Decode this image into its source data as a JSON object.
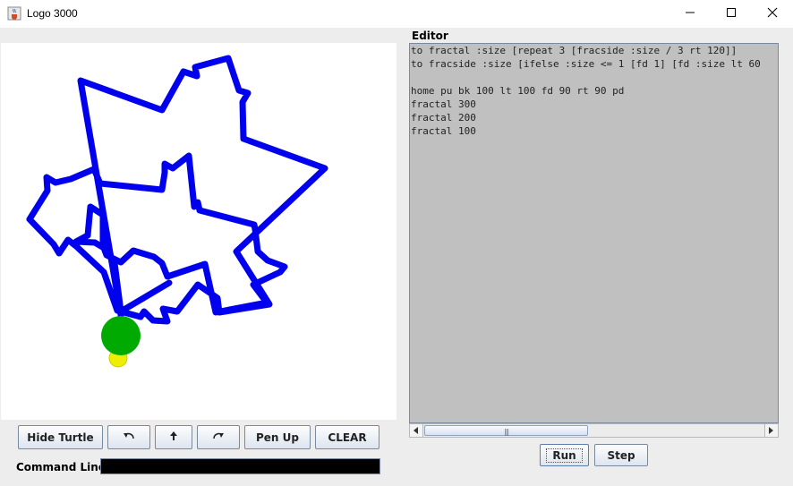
{
  "window": {
    "title": "Logo 3000",
    "icon": "java-cup-icon",
    "controls": [
      "minimize-icon",
      "maximize-icon",
      "close-icon"
    ]
  },
  "canvas": {
    "pen_color": "#0000ee",
    "turtle_body_color": "#00aa00",
    "turtle_head_color": "#eeee00",
    "background": "#ffffff"
  },
  "toolbar": {
    "hide_turtle": "Hide Turtle",
    "rotate_left_icon": "rotate-left-icon",
    "forward_icon": "arrow-up-icon",
    "rotate_right_icon": "rotate-right-icon",
    "pen_up": "Pen Up",
    "clear": "CLEAR"
  },
  "command_line": {
    "label": "Command Line:",
    "value": ""
  },
  "editor": {
    "label": "Editor",
    "lines": [
      "to fractal :size [repeat 3 [fracside :size / 3 rt 120]]",
      "to fracside :size [ifelse :size <= 1 [fd 1] [fd :size lt 60",
      "",
      "home pu bk 100 lt 100 fd 90 rt 90 pd",
      "fractal 300",
      "fractal 200",
      "fractal 100"
    ],
    "background": "#c0c0c0"
  },
  "editor_buttons": {
    "run": "Run",
    "step": "Step"
  }
}
